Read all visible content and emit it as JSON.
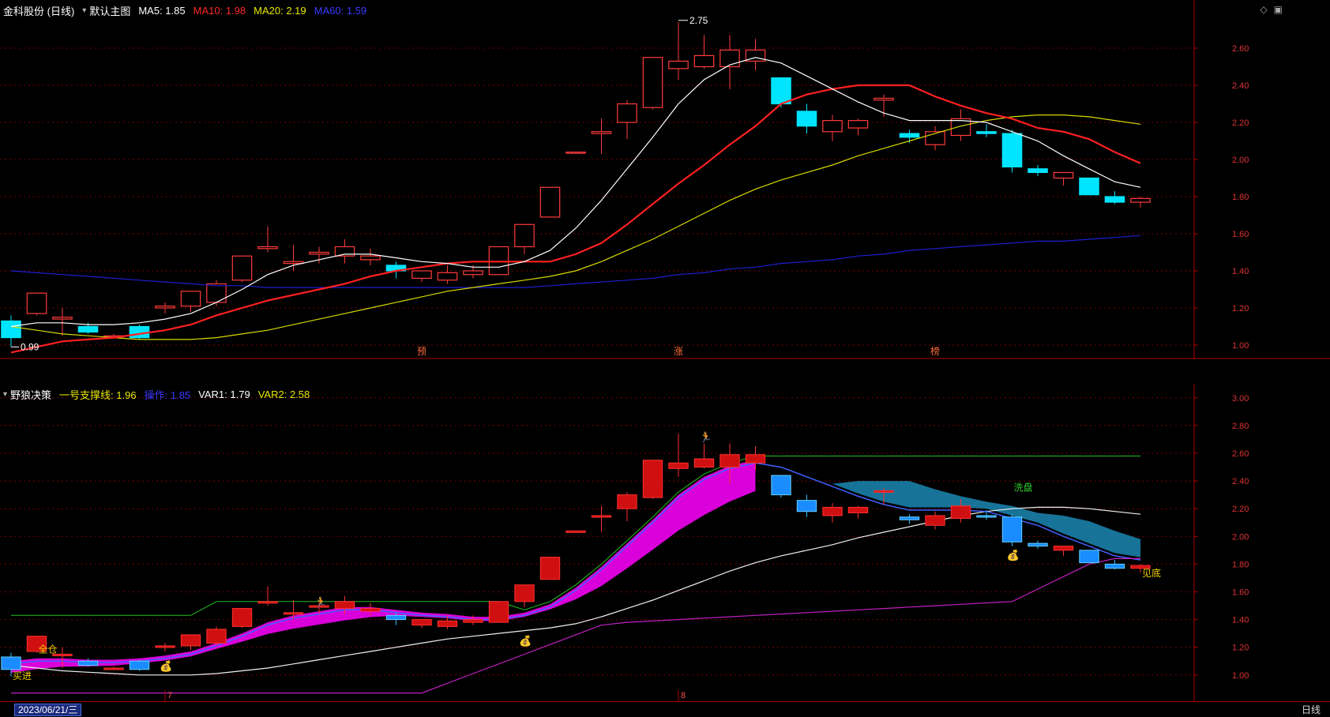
{
  "main_pane": {
    "title": "金科股份 (日线)",
    "template": "默认主图",
    "indicators": [
      {
        "label": "MA5:",
        "value": "1.85",
        "color": "#ffffff"
      },
      {
        "label": "MA10:",
        "value": "1.98",
        "color": "#ff2a2a"
      },
      {
        "label": "MA20:",
        "value": "2.19",
        "color": "#e8e800"
      },
      {
        "label": "MA60:",
        "value": "1.59",
        "color": "#2a2aff"
      }
    ],
    "high_label": "2.75",
    "low_label": "0.99",
    "event_marks": [
      "预",
      "涨",
      "榜"
    ],
    "y_ticks": [
      "2.60",
      "2.40",
      "2.20",
      "2.00",
      "1.80",
      "1.60",
      "1.40",
      "1.20",
      "1.00"
    ]
  },
  "sub_pane": {
    "title": "野狼决策",
    "indicators": [
      {
        "label": "一号支撑线:",
        "value": "1.96",
        "color": "#e8e800"
      },
      {
        "label": "操作:",
        "value": "1.85",
        "color": "#2a2aff"
      },
      {
        "label": "VAR1:",
        "value": "1.79",
        "color": "#ffffff"
      },
      {
        "label": "VAR2:",
        "value": "2.58",
        "color": "#e8e800"
      }
    ],
    "signals": {
      "buy": "买进",
      "full": "全仓",
      "wash": "洗盘",
      "bottom": "见底"
    },
    "y_ticks": [
      "3.00",
      "2.80",
      "2.60",
      "2.40",
      "2.20",
      "2.00",
      "1.80",
      "1.60",
      "1.40",
      "1.20",
      "1.00"
    ]
  },
  "status": {
    "date": "2023/06/21/三",
    "month_marks": [
      "7",
      "8"
    ],
    "period_tab": "日线"
  },
  "icons": [
    "diamond-icon",
    "window-restore-icon",
    "collapse-arrow-icon"
  ],
  "chart_data": {
    "type": "candlestick",
    "y_range": [
      0.9,
      2.8
    ],
    "candles": [
      [
        1.13,
        1.16,
        0.99,
        1.04
      ],
      [
        1.17,
        1.27,
        1.16,
        1.28
      ],
      [
        1.14,
        1.2,
        1.05,
        1.15
      ],
      [
        1.1,
        1.12,
        1.06,
        1.07
      ],
      [
        1.05,
        1.06,
        1.04,
        1.05
      ],
      [
        1.1,
        1.11,
        1.03,
        1.04
      ],
      [
        1.2,
        1.23,
        1.17,
        1.21
      ],
      [
        1.21,
        1.22,
        1.18,
        1.29
      ],
      [
        1.23,
        1.35,
        1.21,
        1.33
      ],
      [
        1.35,
        1.37,
        1.34,
        1.48
      ],
      [
        1.52,
        1.64,
        1.5,
        1.53
      ],
      [
        1.44,
        1.54,
        1.4,
        1.45
      ],
      [
        1.49,
        1.53,
        1.44,
        1.5
      ],
      [
        1.48,
        1.57,
        1.44,
        1.53
      ],
      [
        1.46,
        1.52,
        1.43,
        1.48
      ],
      [
        1.43,
        1.45,
        1.36,
        1.4
      ],
      [
        1.36,
        1.4,
        1.34,
        1.4
      ],
      [
        1.35,
        1.43,
        1.33,
        1.39
      ],
      [
        1.38,
        1.43,
        1.36,
        1.4
      ],
      [
        1.38,
        1.4,
        1.38,
        1.53
      ],
      [
        1.53,
        1.55,
        1.49,
        1.65
      ],
      [
        1.69,
        1.7,
        1.7,
        1.85
      ],
      [
        2.04,
        2.04,
        2.04,
        2.04
      ],
      [
        2.14,
        2.22,
        2.03,
        2.15
      ],
      [
        2.2,
        2.32,
        2.11,
        2.3
      ],
      [
        2.28,
        2.55,
        2.27,
        2.55
      ],
      [
        2.49,
        2.74,
        2.43,
        2.53
      ],
      [
        2.5,
        2.67,
        2.49,
        2.56
      ],
      [
        2.5,
        2.67,
        2.38,
        2.59
      ],
      [
        2.53,
        2.65,
        2.48,
        2.59
      ],
      [
        2.44,
        2.44,
        2.28,
        2.3
      ],
      [
        2.26,
        2.3,
        2.14,
        2.18
      ],
      [
        2.15,
        2.24,
        2.1,
        2.21
      ],
      [
        2.17,
        2.22,
        2.13,
        2.21
      ],
      [
        2.32,
        2.35,
        2.23,
        2.33
      ],
      [
        2.14,
        2.16,
        2.09,
        2.12
      ],
      [
        2.08,
        2.18,
        2.05,
        2.15
      ],
      [
        2.13,
        2.27,
        2.1,
        2.22
      ],
      [
        2.15,
        2.19,
        2.12,
        2.14
      ],
      [
        2.14,
        2.16,
        1.93,
        1.96
      ],
      [
        1.95,
        1.97,
        1.91,
        1.93
      ],
      [
        1.9,
        1.93,
        1.86,
        1.93
      ],
      [
        1.9,
        1.9,
        1.81,
        1.81
      ],
      [
        1.8,
        1.83,
        1.76,
        1.77
      ],
      [
        1.77,
        1.8,
        1.74,
        1.79
      ]
    ],
    "ma5": [
      1.1,
      1.12,
      1.12,
      1.11,
      1.11,
      1.12,
      1.14,
      1.17,
      1.23,
      1.3,
      1.38,
      1.43,
      1.46,
      1.49,
      1.49,
      1.47,
      1.45,
      1.44,
      1.42,
      1.42,
      1.45,
      1.51,
      1.63,
      1.78,
      1.95,
      2.12,
      2.3,
      2.43,
      2.51,
      2.55,
      2.52,
      2.45,
      2.38,
      2.31,
      2.25,
      2.21,
      2.21,
      2.21,
      2.2,
      2.15,
      2.1,
      2.02,
      1.95,
      1.88,
      1.85
    ],
    "ma10": [
      0.96,
      0.99,
      1.02,
      1.03,
      1.04,
      1.06,
      1.08,
      1.11,
      1.16,
      1.2,
      1.24,
      1.27,
      1.3,
      1.33,
      1.37,
      1.4,
      1.42,
      1.44,
      1.45,
      1.45,
      1.45,
      1.45,
      1.49,
      1.55,
      1.65,
      1.76,
      1.87,
      1.97,
      2.08,
      2.18,
      2.3,
      2.35,
      2.38,
      2.4,
      2.4,
      2.4,
      2.34,
      2.29,
      2.25,
      2.22,
      2.17,
      2.15,
      2.11,
      2.04,
      1.98
    ],
    "ma20": [
      1.1,
      1.08,
      1.06,
      1.05,
      1.04,
      1.03,
      1.03,
      1.03,
      1.04,
      1.06,
      1.08,
      1.11,
      1.14,
      1.17,
      1.2,
      1.23,
      1.26,
      1.29,
      1.31,
      1.33,
      1.35,
      1.37,
      1.4,
      1.45,
      1.51,
      1.57,
      1.64,
      1.71,
      1.78,
      1.84,
      1.89,
      1.93,
      1.97,
      2.02,
      2.06,
      2.1,
      2.14,
      2.18,
      2.21,
      2.23,
      2.24,
      2.24,
      2.23,
      2.21,
      2.19
    ],
    "ma60": [
      1.4,
      1.39,
      1.38,
      1.37,
      1.36,
      1.35,
      1.34,
      1.33,
      1.32,
      1.32,
      1.31,
      1.31,
      1.31,
      1.31,
      1.31,
      1.31,
      1.31,
      1.31,
      1.31,
      1.31,
      1.31,
      1.32,
      1.33,
      1.34,
      1.35,
      1.36,
      1.38,
      1.39,
      1.41,
      1.42,
      1.44,
      1.45,
      1.46,
      1.48,
      1.49,
      1.51,
      1.52,
      1.53,
      1.54,
      1.55,
      1.56,
      1.56,
      1.57,
      1.58,
      1.59
    ]
  }
}
